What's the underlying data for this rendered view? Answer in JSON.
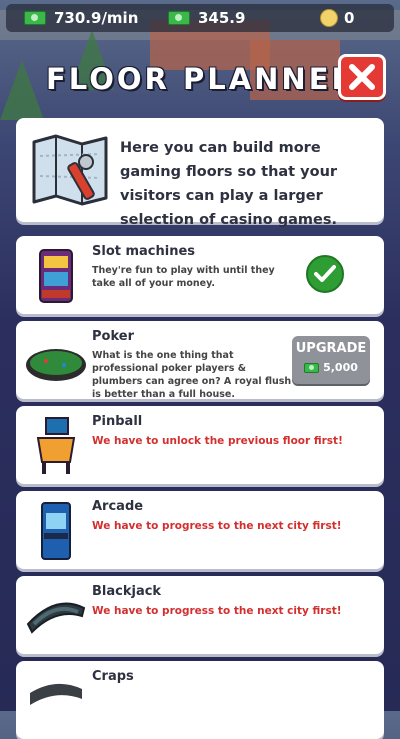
{
  "hud": {
    "income_rate": "730.9/min",
    "cash": "345.9",
    "coins": "0"
  },
  "screen": {
    "title": "FLOOR PLANNER",
    "intro": "Here you can build more gaming floors so that your visitors can play a larger selection of casino games."
  },
  "floors": [
    {
      "name": "Slot machines",
      "description": "They're fun to play with until they take all of your money.",
      "status": "completed",
      "icon": "slot-machine-icon"
    },
    {
      "name": "Poker",
      "description": "What is the one thing that professional poker players & plumbers can agree on? A royal flush is better than a full house.",
      "status": "upgradable",
      "button_label": "UPGRADE",
      "cost": "5,000",
      "icon": "poker-table-icon"
    },
    {
      "name": "Pinball",
      "lock_message": "We have to unlock the previous floor first!",
      "status": "locked",
      "icon": "pinball-machine-icon"
    },
    {
      "name": "Arcade",
      "lock_message": "We have to progress to the next city first!",
      "status": "locked",
      "icon": "arcade-cabinet-icon"
    },
    {
      "name": "Blackjack",
      "lock_message": "We have to progress to the next city first!",
      "status": "locked",
      "icon": "blackjack-table-icon"
    },
    {
      "name": "Craps",
      "status": "locked",
      "icon": "craps-table-icon"
    }
  ],
  "colors": {
    "lock_text": "#d32f2f",
    "check_green": "#2e9d33",
    "close_red": "#e53935",
    "upgrade_gray": "#8f9399"
  }
}
